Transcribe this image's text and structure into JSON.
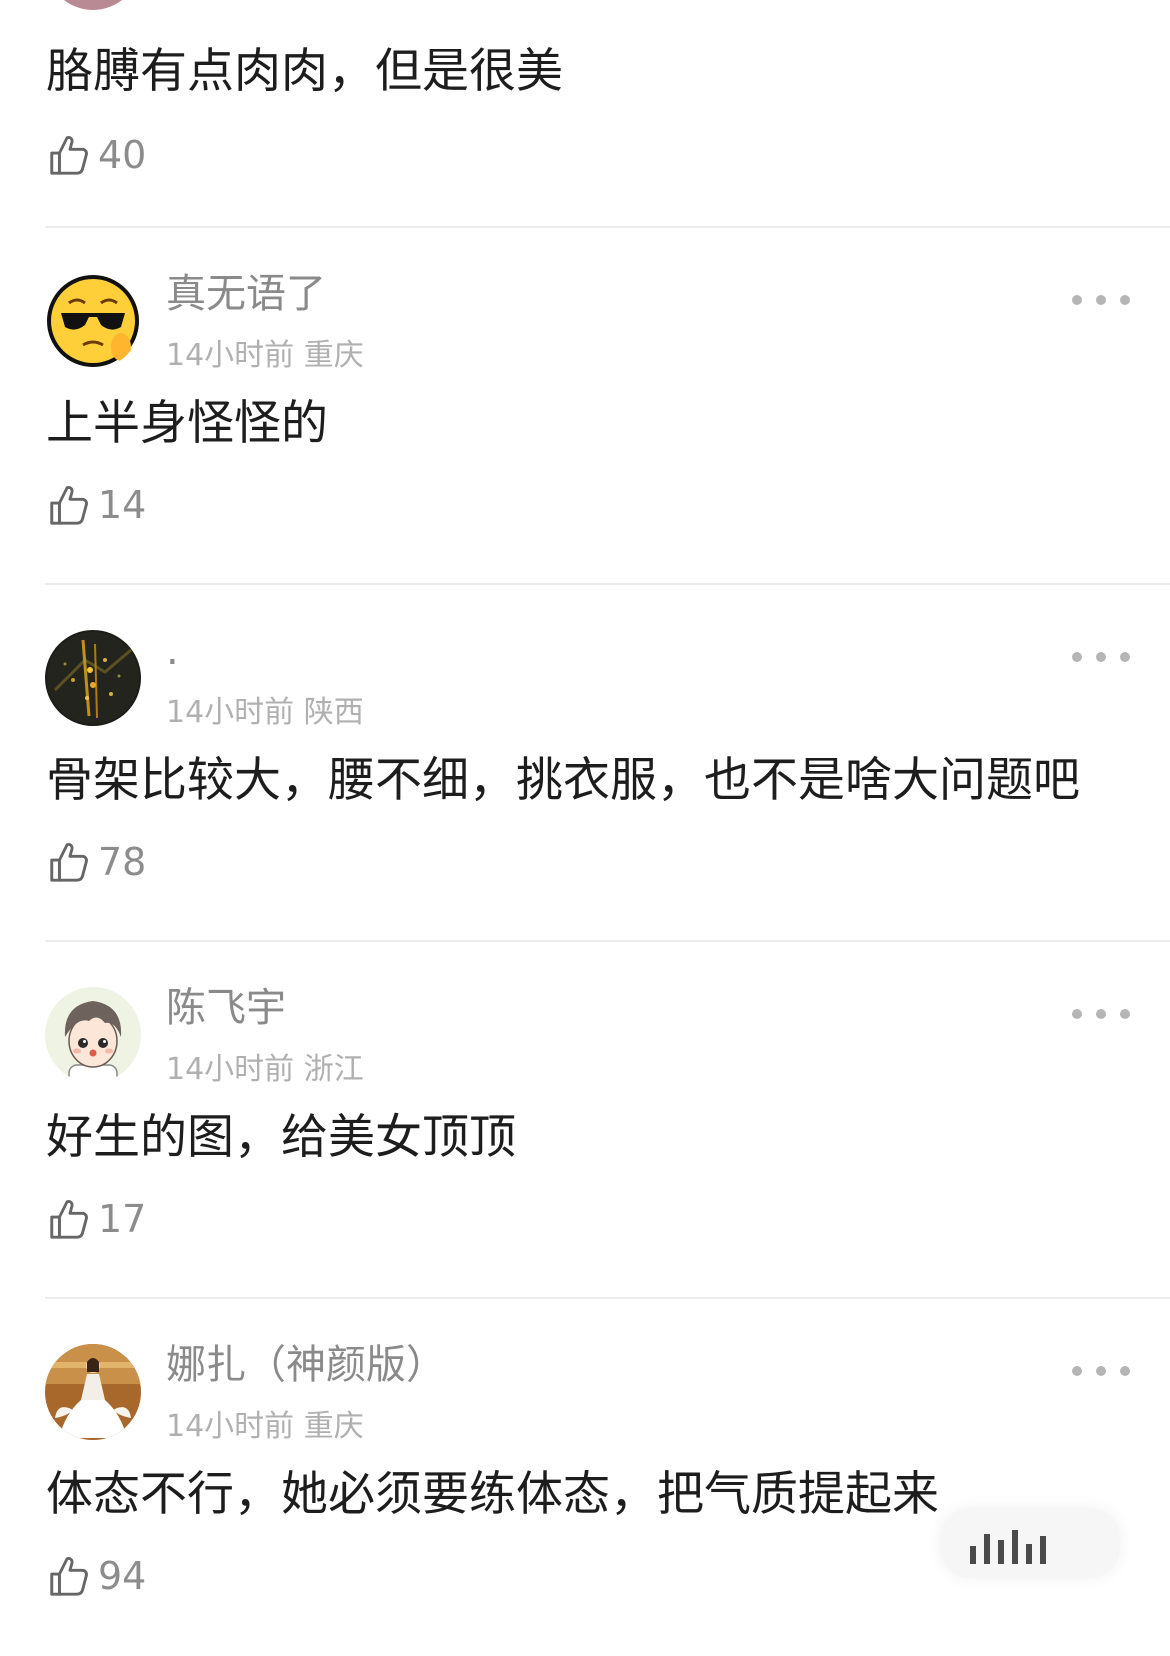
{
  "top_comment": {
    "body": "胳膊有点肉肉，但是很美",
    "likes": "40"
  },
  "comments": [
    {
      "username": "真无语了",
      "time": "14小时前",
      "location": "重庆",
      "body": "上半身怪怪的",
      "likes": "14",
      "avatar_icon": "sunglasses-emoji-icon"
    },
    {
      "username": ".",
      "time": "14小时前",
      "location": "陕西",
      "body": "骨架比较大，腰不细，挑衣服，也不是啥大问题吧",
      "likes": "78",
      "avatar_icon": "night-city-photo"
    },
    {
      "username": "陈飞宇",
      "time": "14小时前",
      "location": "浙江",
      "body": "好生的图，给美女顶顶",
      "likes": "17",
      "avatar_icon": "cartoon-boy-avatar"
    },
    {
      "username": "娜扎（神颜版）",
      "time": "14小时前",
      "location": "重庆",
      "body": "体态不行，她必须要练体态，把气质提起来",
      "likes": "94",
      "avatar_icon": "woman-in-white-dress-photo"
    }
  ],
  "colors": {
    "username": "#8a8a8a",
    "meta": "#b0b0b0",
    "body": "#1d1d1d",
    "divider": "#ececec"
  }
}
